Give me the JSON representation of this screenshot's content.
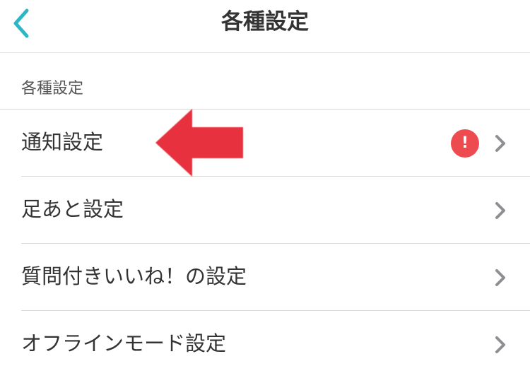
{
  "header": {
    "title": "各種設定",
    "back_icon": "chevron-left-icon"
  },
  "section": {
    "title": "各種設定"
  },
  "settings_items": [
    {
      "label": "通知設定",
      "badge": "!",
      "has_alert": true
    },
    {
      "label": "足あと設定",
      "has_alert": false
    },
    {
      "label": "質問付きいいね！の設定",
      "has_alert": false
    },
    {
      "label": "オフラインモード設定",
      "has_alert": false
    }
  ],
  "colors": {
    "accent": "#2bb8c4",
    "alert": "#ee4b50",
    "annotation_arrow": "#e8313f",
    "chevron": "#8e8e93",
    "divider": "#d9d9d9"
  }
}
